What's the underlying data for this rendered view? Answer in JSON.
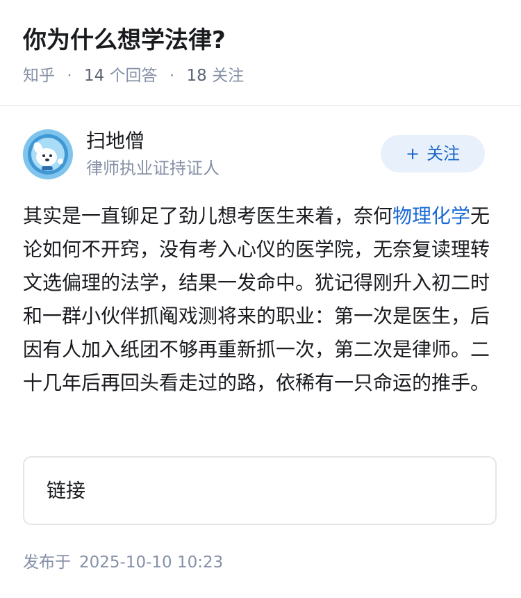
{
  "question": {
    "title": "你为什么想学法律?",
    "source": "知乎",
    "answer_count": "14",
    "answer_unit": "个回答",
    "follower_count": "18",
    "follower_unit": "关注"
  },
  "author": {
    "name": "扫地僧",
    "headline": "律师执业证持证人",
    "follow_label": "关注",
    "follow_plus": "+"
  },
  "answer": {
    "text_before_link": "其实是一直铆足了劲儿想考医生来着，奈何",
    "link_text": "物理化学",
    "text_after_link": "无论如何不开窍，没有考入心仪的医学院，无奈复读理转文选偏理的法学，结果一发命中。犹记得刚升入初二时和一群小伙伴抓阄戏测将来的职业：第一次是医生，后因有人加入纸团不够再重新抓一次，第二次是律师。二十几年后再回头看走过的路，依稀有一只命运的推手。"
  },
  "link_card": {
    "label": "链接"
  },
  "publish": {
    "label": "发布于",
    "datetime": "2025-10-10 10:23"
  },
  "colors": {
    "accent": "#1766c7",
    "follow_bg": "#e8f1fb",
    "meta_gray": "#8590a6",
    "link_blue": "#1a6ad6"
  },
  "icons": {
    "avatar": "cartoon-dog-astronaut-avatar"
  }
}
